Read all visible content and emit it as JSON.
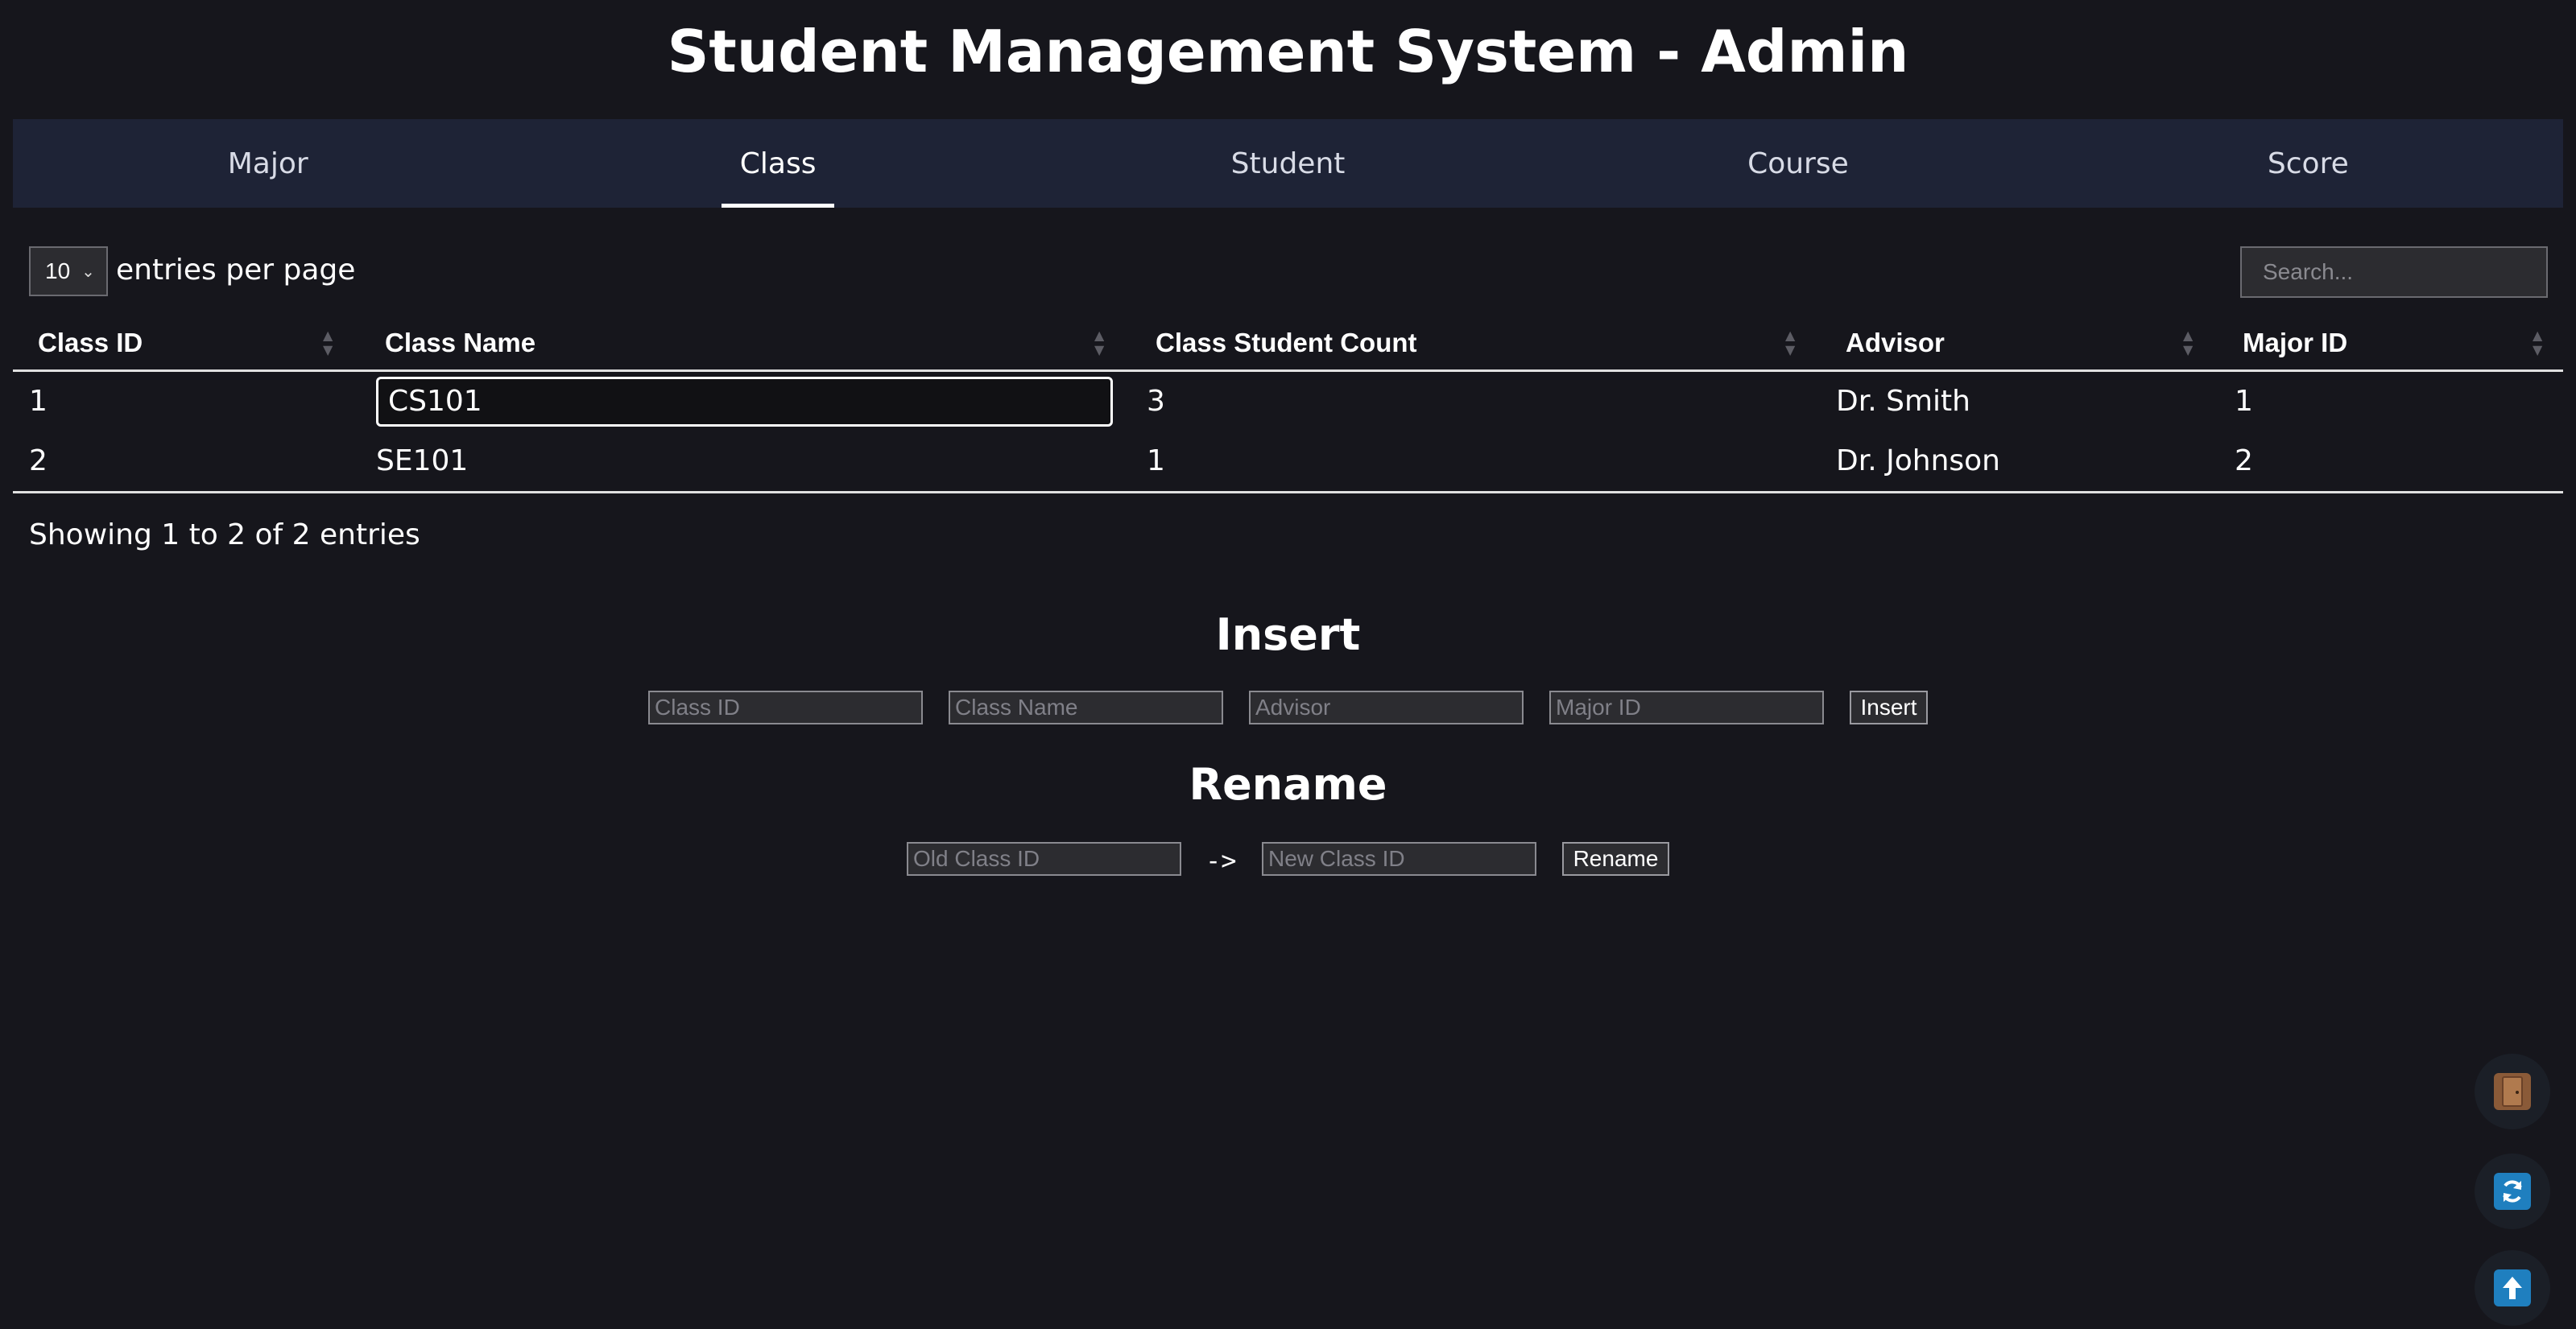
{
  "app": {
    "title": "Student Management System - Admin"
  },
  "tabs": [
    {
      "label": "Major"
    },
    {
      "label": "Class"
    },
    {
      "label": "Student"
    },
    {
      "label": "Course"
    },
    {
      "label": "Score"
    }
  ],
  "active_tab": "Class",
  "table_controls": {
    "entries_value": "10",
    "entries_label": "entries per page",
    "search_placeholder": "Search..."
  },
  "table": {
    "columns": [
      "Class ID",
      "Class Name",
      "Class Student Count",
      "Advisor",
      "Major ID"
    ],
    "rows": [
      {
        "class_id": "1",
        "class_name": "CS101",
        "count": "3",
        "advisor": "Dr. Smith",
        "major_id": "1"
      },
      {
        "class_id": "2",
        "class_name": "SE101",
        "count": "1",
        "advisor": "Dr. Johnson",
        "major_id": "2"
      }
    ],
    "info": "Showing 1 to 2 of 2 entries"
  },
  "insert": {
    "title": "Insert",
    "fields": [
      "Class ID",
      "Class Name",
      "Advisor",
      "Major ID"
    ],
    "button": "Insert"
  },
  "rename": {
    "title": "Rename",
    "old_placeholder": "Old Class ID",
    "arrow": "->",
    "new_placeholder": "New Class ID",
    "button": "Rename"
  },
  "floating_buttons": [
    {
      "icon": "door-icon",
      "color": "#8a5a38"
    },
    {
      "icon": "refresh-icon",
      "color": "#1f7fbf"
    },
    {
      "icon": "arrow-up-icon",
      "color": "#1f7fbf"
    }
  ]
}
